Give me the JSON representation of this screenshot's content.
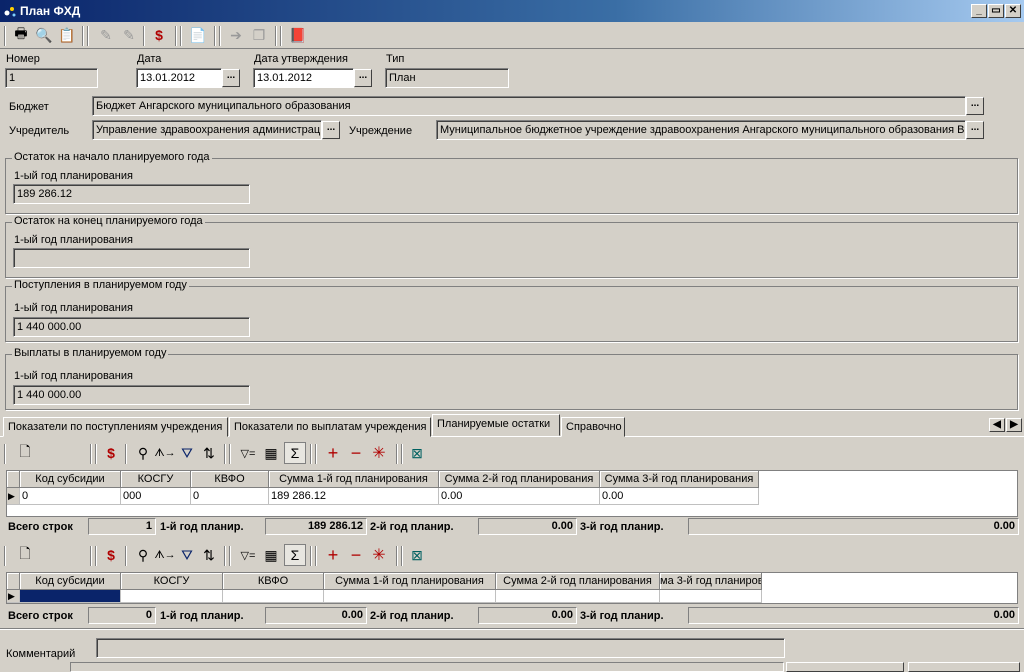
{
  "window": {
    "title": "План ФХД"
  },
  "header": {
    "number_label": "Номер",
    "number_value": "1",
    "date_label": "Дата",
    "date_value": "13.01.2012",
    "approval_date_label": "Дата утверждения",
    "approval_date_value": "13.01.2012",
    "type_label": "Тип",
    "type_value": "План",
    "budget_label": "Бюджет",
    "budget_value": "Бюджет Ангарского муниципального образования",
    "founder_label": "Учредитель",
    "founder_value": "Управление здравоохранения администрац",
    "institution_label": "Учреждение",
    "institution_value": "Муниципальное бюджетное учреждение здравоохранения Ангарского муниципального образования В",
    "dots": "..."
  },
  "groups": [
    {
      "title": "Остаток на начало планируемого года",
      "sub": "1-ый год планирования",
      "value": "189 286.12"
    },
    {
      "title": "Остаток на конец планируемого года",
      "sub": "1-ый год планирования",
      "value": ""
    },
    {
      "title": "Поступления в планируемом году",
      "sub": "1-ый год планирования",
      "value": "1 440 000.00"
    },
    {
      "title": "Выплаты в планируемом году",
      "sub": "1-ый год планирования",
      "value": "1 440 000.00"
    }
  ],
  "tabs": [
    "Показатели по поступлениям учреждения",
    "Показатели по выплатам учреждения",
    "Планируемые остатки",
    "Справочно"
  ],
  "active_tab": "Планируемые остатки",
  "grid1": {
    "columns": [
      "Код субсидии",
      "КОСГУ",
      "КВФО",
      "Сумма 1-й год планирования",
      "Сумма 2-й год планирования",
      "Сумма 3-й год планирования"
    ],
    "row": [
      "0",
      "000",
      "0",
      "189 286.12",
      "0.00",
      "0.00"
    ],
    "totals": {
      "rows_label": "Всего строк",
      "rows": "1",
      "y1_label": "1-й год планир.",
      "y1": "189 286.12",
      "y2_label": "2-й год планир.",
      "y2": "0.00",
      "y3_label": "3-й год планир.",
      "y3": "0.00"
    }
  },
  "grid2": {
    "columns": [
      "Код субсидии",
      "КОСГУ",
      "КВФО",
      "Сумма 1-й год планирования",
      "Сумма 2-й год планирования",
      "ма 3-й год планиров"
    ],
    "totals": {
      "rows_label": "Всего строк",
      "rows": "0",
      "y1_label": "1-й год планир.",
      "y1": "0.00",
      "y2_label": "2-й год планир.",
      "y2": "0.00",
      "y3_label": "3-й год планир.",
      "y3": "0.00"
    }
  },
  "footer": {
    "comment_label": "Комментарий",
    "comment_value": ""
  },
  "colors": {
    "titlebar": "#0a246a",
    "selection": "#0a246a",
    "face": "#d4d0c8"
  }
}
